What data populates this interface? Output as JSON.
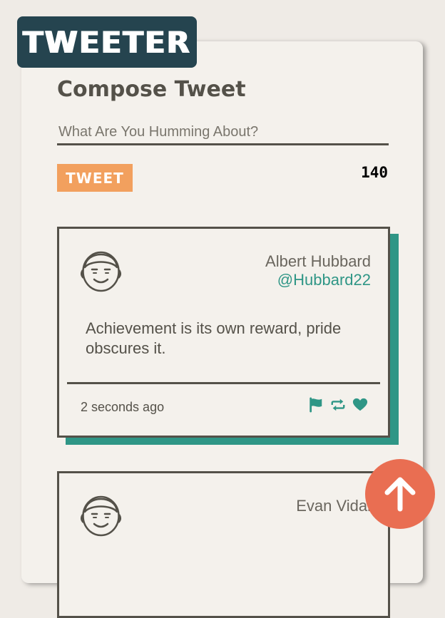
{
  "app": {
    "logo_text": "TWEETER"
  },
  "compose": {
    "title": "Compose Tweet",
    "placeholder": "What Are You Humming About?",
    "value": "",
    "tweet_button_label": "TWEET",
    "char_count": "140"
  },
  "tweets": [
    {
      "author_name": "Albert Hubbard",
      "handle": "@Hubbard22",
      "text": "Achievement is its own reward, pride obscures it.",
      "time": "2 seconds ago",
      "actions": [
        "flag-icon",
        "retweet-icon",
        "heart-icon"
      ]
    },
    {
      "author_name": "Evan Vidal"
    }
  ],
  "colors": {
    "logo_bg": "#25444f",
    "tweet_button": "#f2a05e",
    "accent_teal": "#2f9686",
    "scroll_button": "#e96e52",
    "text": "#545149"
  },
  "icons": {
    "scroll_top": "arrow-up-icon",
    "avatar": "avatar-icon"
  }
}
